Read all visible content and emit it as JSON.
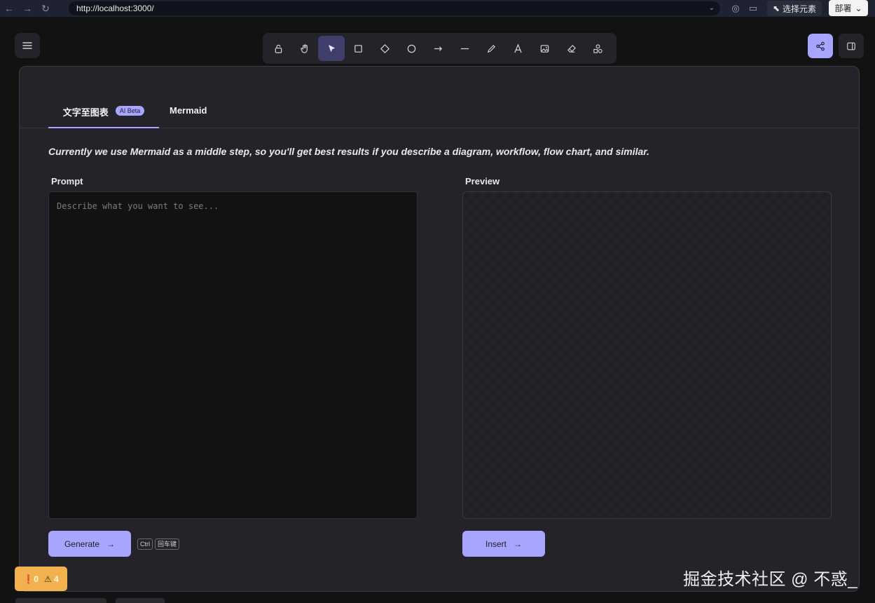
{
  "browser": {
    "url": "http://localhost:3000/",
    "pick_element_label": "选择元素",
    "deploy_label": "部署"
  },
  "toolbar": {
    "tools": [
      "lock-icon",
      "hand-icon",
      "pointer-icon",
      "rectangle-icon",
      "diamond-icon",
      "ellipse-icon",
      "arrow-icon",
      "line-icon",
      "pencil-icon",
      "text-icon",
      "image-icon",
      "eraser-icon",
      "shapes-icon"
    ],
    "active_tool": "pointer-icon"
  },
  "dialog": {
    "tabs": [
      {
        "label": "文字至图表",
        "badge": "AI Beta"
      },
      {
        "label": "Mermaid"
      }
    ],
    "description": "Currently we use Mermaid as a middle step, so you'll get best results if you describe a diagram, workflow, flow chart, and similar.",
    "prompt_label": "Prompt",
    "prompt_placeholder": "Describe what you want to see...",
    "preview_label": "Preview",
    "generate_label": "Generate",
    "shortcut_keys": [
      "Ctrl",
      "回车键"
    ],
    "insert_label": "Insert"
  },
  "status": {
    "errors": "0",
    "warnings": "4"
  },
  "watermark": "掘金技术社区 @ 不惑_",
  "colors": {
    "accent": "#a8a5ff",
    "dialog_bg": "#232329",
    "prompt_bg": "#121212",
    "status_bg": "#f0b14e"
  }
}
